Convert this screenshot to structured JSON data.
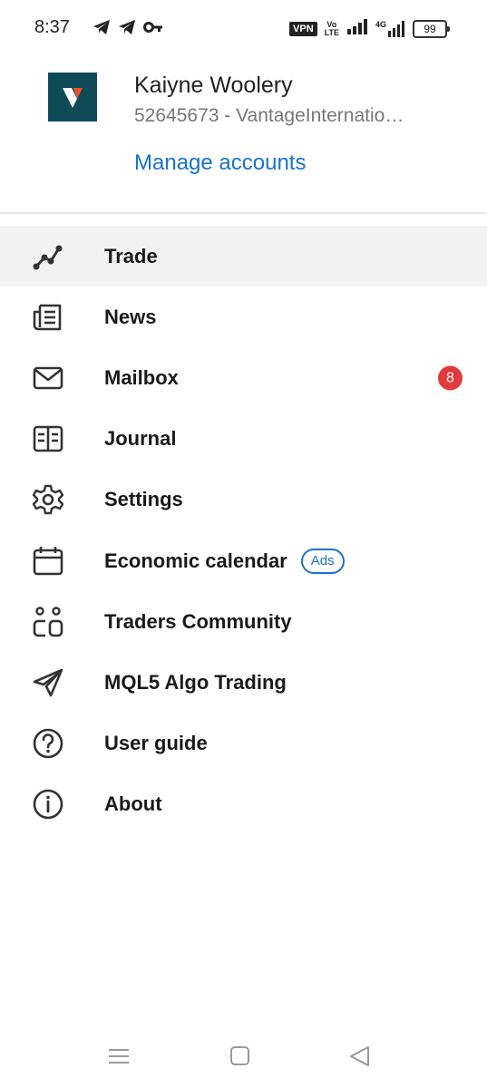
{
  "status_bar": {
    "time": "8:37",
    "left_icons": [
      "telegram-icon",
      "telegram-icon",
      "key-icon"
    ],
    "vpn_label": "VPN",
    "volte_top": "Vo",
    "volte_bottom": "LTE",
    "network_label": "4G",
    "battery_level": "99"
  },
  "account": {
    "logo_letter": "V",
    "name": "Kaiyne Woolery",
    "number": "52645673 - VantageInternatio…",
    "manage_link": "Manage accounts"
  },
  "menu": [
    {
      "label": "Trade",
      "icon": "trade-chart-icon",
      "active": true
    },
    {
      "label": "News",
      "icon": "news-icon"
    },
    {
      "label": "Mailbox",
      "icon": "mail-icon",
      "badge": "8"
    },
    {
      "label": "Journal",
      "icon": "journal-icon"
    },
    {
      "label": "Settings",
      "icon": "gear-icon"
    },
    {
      "label": "Economic calendar",
      "icon": "calendar-icon",
      "tag": "Ads"
    },
    {
      "label": "Traders Community",
      "icon": "community-icon"
    },
    {
      "label": "MQL5 Algo Trading",
      "icon": "send-icon"
    },
    {
      "label": "User guide",
      "icon": "help-icon"
    },
    {
      "label": "About",
      "icon": "info-icon"
    }
  ],
  "nav_bar": {
    "buttons": [
      "menu-icon",
      "home-icon",
      "back-icon"
    ]
  },
  "colors": {
    "accent": "#1a73c8",
    "badge": "#e03a3e",
    "logo_bg": "#0e4a55",
    "logo_mark": "#e8502f",
    "active_row": "#f2f2f2"
  }
}
